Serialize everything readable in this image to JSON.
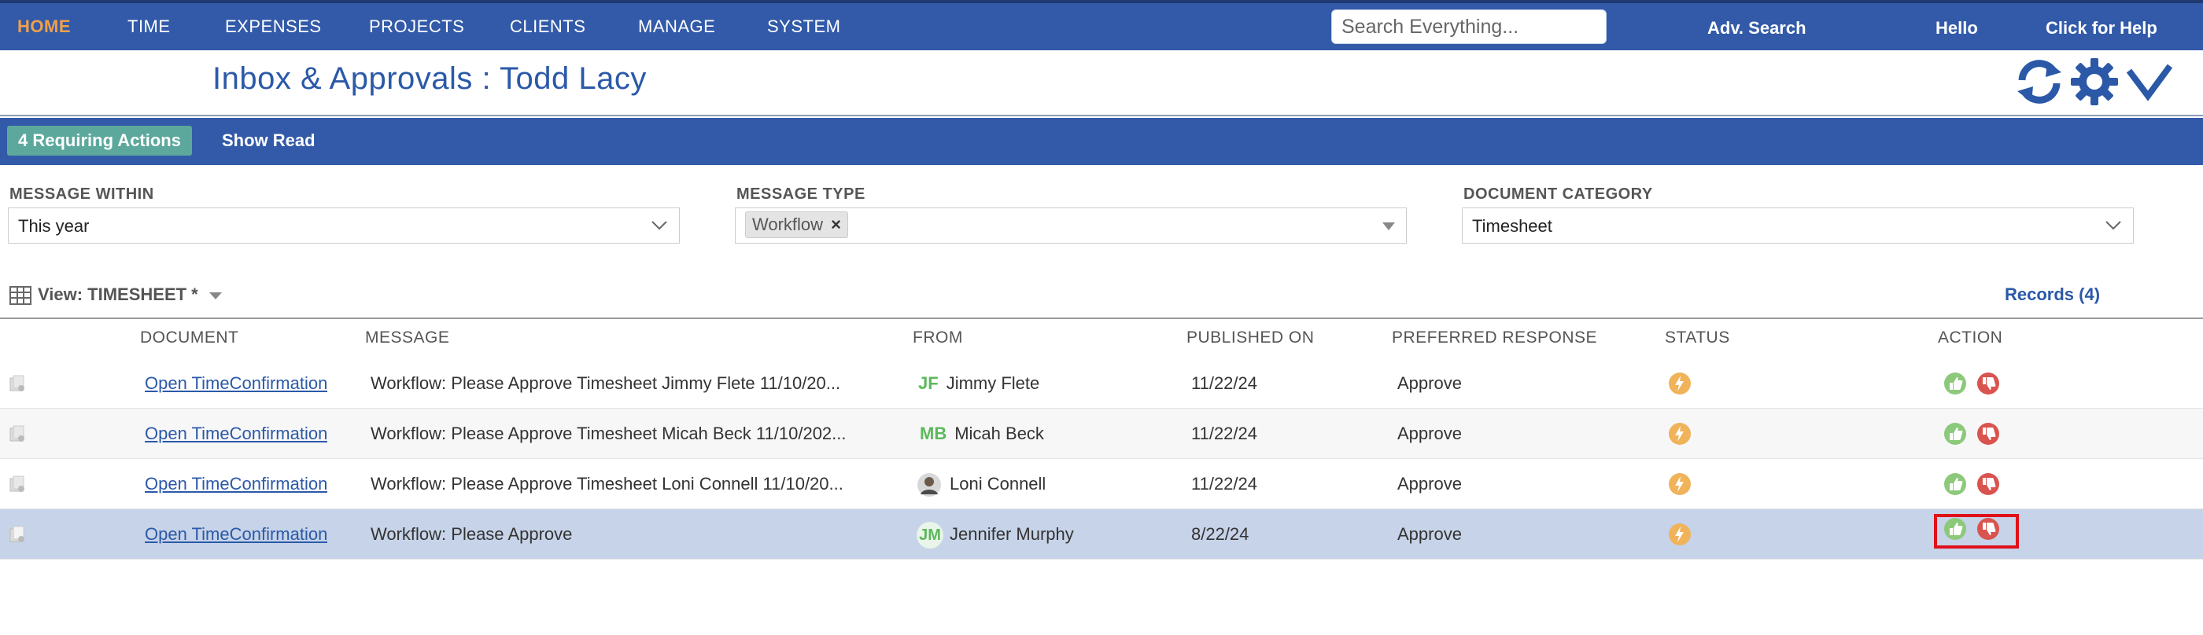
{
  "nav": {
    "items": [
      {
        "label": "HOME",
        "active": true
      },
      {
        "label": "TIME"
      },
      {
        "label": "EXPENSES"
      },
      {
        "label": "PROJECTS"
      },
      {
        "label": "CLIENTS"
      },
      {
        "label": "MANAGE"
      },
      {
        "label": "SYSTEM"
      }
    ],
    "search_placeholder": "Search Everything...",
    "adv_search": "Adv. Search",
    "hello": "Hello",
    "help": "Click for Help"
  },
  "header": {
    "title": "Inbox & Approvals : Todd Lacy",
    "icons": [
      "refresh-icon",
      "gear-icon",
      "checkmark-icon"
    ]
  },
  "actionbar": {
    "requiring": "4 Requiring Actions",
    "show_read": "Show Read"
  },
  "filters": {
    "message_within": {
      "label": "MESSAGE WITHIN",
      "value": "This year"
    },
    "message_type": {
      "label": "MESSAGE TYPE",
      "tag": "Workflow",
      "tag_remove": "×"
    },
    "document_category": {
      "label": "DOCUMENT CATEGORY",
      "value": "Timesheet"
    }
  },
  "view": {
    "label": "View: TIMESHEET *",
    "records": "Records (4)"
  },
  "table": {
    "columns": [
      "DOCUMENT",
      "MESSAGE",
      "FROM",
      "PUBLISHED ON",
      "PREFERRED RESPONSE",
      "STATUS",
      "ACTION"
    ],
    "rows": [
      {
        "document": "Open TimeConfirmation",
        "message": "Workflow: Please Approve Timesheet Jimmy Flete 11/10/20...",
        "from_initials": "JF",
        "from": "Jimmy Flete",
        "published": "11/22/24",
        "response": "Approve"
      },
      {
        "document": "Open TimeConfirmation",
        "message": "Workflow: Please Approve Timesheet Micah Beck 11/10/202...",
        "from_initials": "MB",
        "from": "Micah Beck",
        "published": "11/22/24",
        "response": "Approve"
      },
      {
        "document": "Open TimeConfirmation",
        "message": "Workflow: Please Approve Timesheet Loni Connell 11/10/20...",
        "from_initials": "",
        "from": "Loni Connell",
        "published": "11/22/24",
        "response": "Approve"
      },
      {
        "document": "Open TimeConfirmation",
        "message": "Workflow: Please Approve",
        "from_initials": "JM",
        "from": "Jennifer Murphy",
        "published": "8/22/24",
        "response": "Approve"
      }
    ]
  },
  "colors": {
    "nav_bg": "#325aa8",
    "accent_orange": "#f0a04b",
    "badge_green": "#5ca89c",
    "link_blue": "#2b59a8",
    "approve_green": "#8cc97a",
    "reject_red": "#d9534f",
    "status_orange": "#f0b35a",
    "selected_row": "#c6d3e8"
  }
}
